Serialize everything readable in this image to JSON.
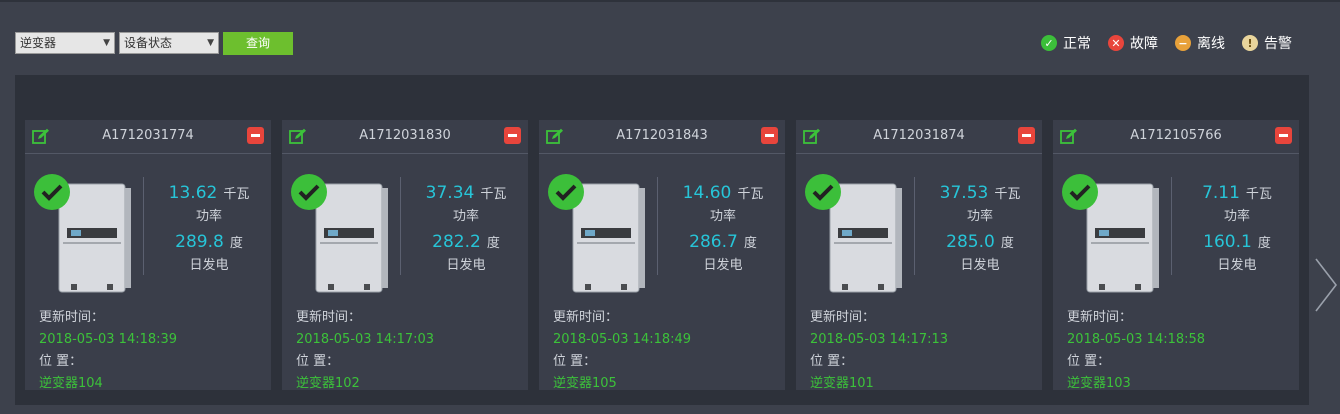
{
  "filters": {
    "device_type": "逆变器",
    "device_status": "设备状态",
    "query_label": "查询"
  },
  "legend": {
    "normal": "正常",
    "fault": "故障",
    "offline": "离线",
    "alarm": "告警",
    "colors": {
      "normal": "#3cbf3a",
      "fault": "#e8453c",
      "offline": "#e8a13a",
      "alarm": "#e9d59c"
    }
  },
  "labels": {
    "power": "功率",
    "daily_gen": "日发电",
    "power_unit": "千瓦",
    "energy_unit": "度",
    "update_time": "更新时间：",
    "location": "位 置："
  },
  "cards": [
    {
      "sn": "A1712031774",
      "status": "normal",
      "power": "13.62",
      "daily": "289.8",
      "time": "2018-05-03 14:18:39",
      "location": "逆变器104"
    },
    {
      "sn": "A1712031830",
      "status": "normal",
      "power": "37.34",
      "daily": "282.2",
      "time": "2018-05-03 14:17:03",
      "location": "逆变器102"
    },
    {
      "sn": "A1712031843",
      "status": "normal",
      "power": "14.60",
      "daily": "286.7",
      "time": "2018-05-03 14:18:49",
      "location": "逆变器105"
    },
    {
      "sn": "A1712031874",
      "status": "normal",
      "power": "37.53",
      "daily": "285.0",
      "time": "2018-05-03 14:17:13",
      "location": "逆变器101"
    },
    {
      "sn": "A1712105766",
      "status": "normal",
      "power": "7.11",
      "daily": "160.1",
      "time": "2018-05-03 14:18:58",
      "location": "逆变器103"
    }
  ]
}
